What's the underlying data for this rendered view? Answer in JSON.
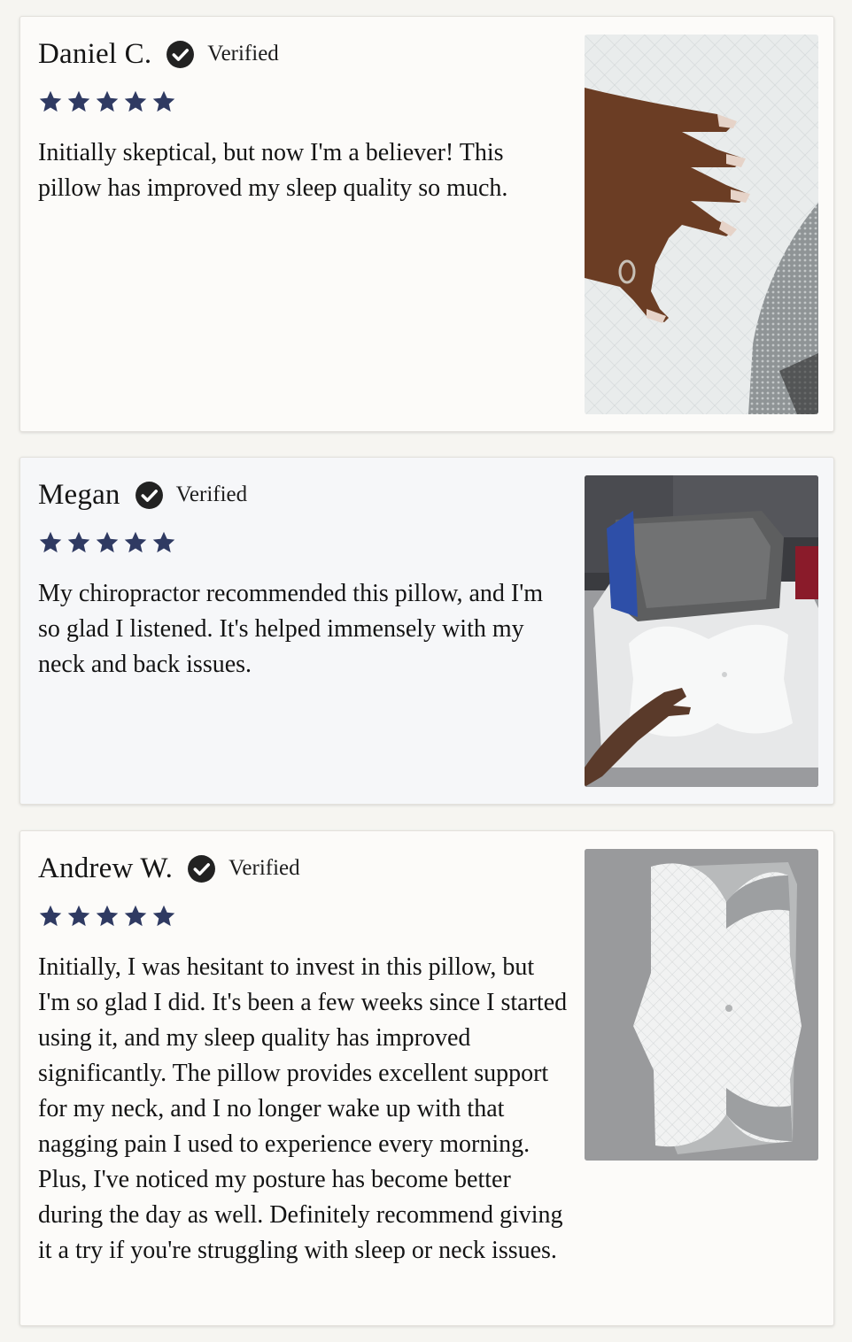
{
  "reviews": [
    {
      "name": "Daniel C.",
      "verified_label": "Verified",
      "rating": 5,
      "body": "Initially skeptical, but now I'm a believer! This pillow has improved my sleep quality so much."
    },
    {
      "name": "Megan",
      "verified_label": "Verified",
      "rating": 5,
      "body": "My chiropractor recommended this pillow, and I'm so glad I listened. It's helped immensely with my neck and back issues."
    },
    {
      "name": "Andrew W.",
      "verified_label": "Verified",
      "rating": 5,
      "body": "Initially, I was hesitant to invest in this pillow, but I'm so glad I did. It's been a few weeks since I started using it, and my sleep quality has improved significantly. The pillow provides excellent support for my neck, and I no longer wake up with that nagging pain I used to experience every morning. Plus, I've noticed my posture has become better during the day as well. Definitely recommend giving it a try if you're struggling with sleep or neck issues."
    }
  ],
  "icons": {
    "verified": "check-circle-icon",
    "star": "star-icon"
  },
  "colors": {
    "star": "#2f3a62",
    "verified_badge": "#222222"
  }
}
